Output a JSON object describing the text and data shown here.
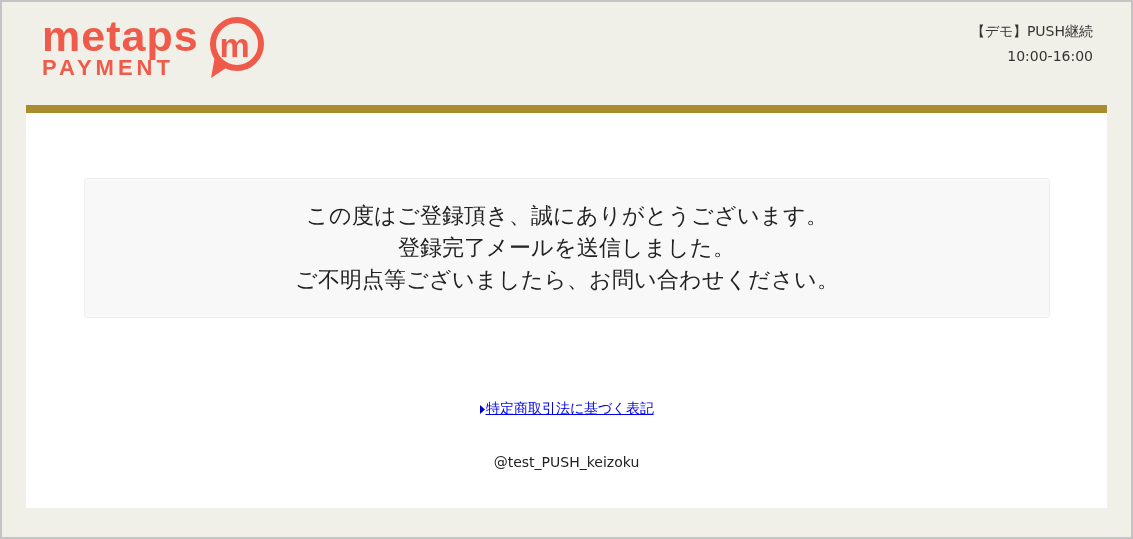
{
  "logo": {
    "word": "metaps",
    "sub": "PAYMENT",
    "badge": "m"
  },
  "header_info": {
    "title": "【デモ】PUSH継続",
    "hours": "10:00-16:00"
  },
  "message": {
    "lines": [
      "この度はご登録頂き、誠にありがとうございます。",
      "登録完了メールを送信しました。",
      "ご不明点等ございましたら、お問い合わせください。"
    ]
  },
  "legal_link": "特定商取引法に基づく表記",
  "account": "@test_PUSH_keizoku"
}
